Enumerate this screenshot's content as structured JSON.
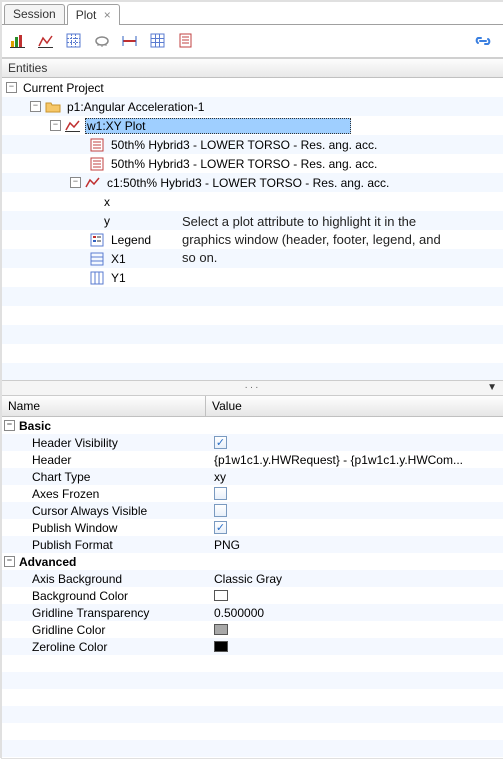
{
  "tabs": {
    "session": "Session",
    "plot": "Plot"
  },
  "entities_header": "Entities",
  "tree": {
    "root": "Current Project",
    "project": "p1:Angular Acceleration-1",
    "w1": "w1:XY Plot",
    "curve_a": "50th% Hybrid3   - LOWER TORSO - Res. ang. acc.",
    "curve_b": "50th% Hybrid3   - LOWER TORSO - Res. ang. acc.",
    "c1": "c1:50th% Hybrid3   - LOWER TORSO - Res. ang. acc.",
    "x": "x",
    "y": "y",
    "legend": "Legend",
    "ax_x": "X1",
    "ax_y": "Y1"
  },
  "hint_text": "Select a plot attribute to highlight it in the graphics window (header, footer, legend, and so on.",
  "table_headers": {
    "name": "Name",
    "value": "Value"
  },
  "props": {
    "basic": {
      "label": "Basic",
      "header_visibility": {
        "label": "Header Visibility",
        "checked": true
      },
      "header": {
        "label": "Header",
        "value": "{p1w1c1.y.HWRequest} - {p1w1c1.y.HWCom..."
      },
      "chart_type": {
        "label": "Chart Type",
        "value": "xy"
      },
      "axes_frozen": {
        "label": "Axes Frozen",
        "checked": false
      },
      "cursor_always_visible": {
        "label": "Cursor Always Visible",
        "checked": false
      },
      "publish_window": {
        "label": "Publish Window",
        "checked": true
      },
      "publish_format": {
        "label": "Publish Format",
        "value": "PNG"
      }
    },
    "advanced": {
      "label": "Advanced",
      "axis_background": {
        "label": "Axis Background",
        "value": "Classic Gray"
      },
      "background_color": {
        "label": "Background Color",
        "swatch": "#ffffff"
      },
      "gridline_transparency": {
        "label": "Gridline Transparency",
        "value": "0.500000"
      },
      "gridline_color": {
        "label": "Gridline Color",
        "swatch": "#a8a8a8"
      },
      "zeroline_color": {
        "label": "Zeroline Color",
        "swatch": "#000000"
      }
    }
  }
}
